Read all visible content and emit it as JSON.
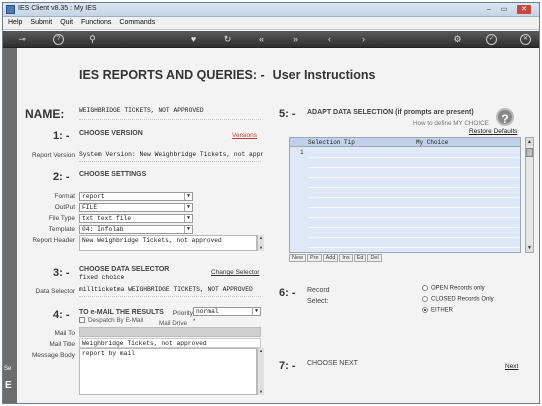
{
  "window": {
    "title": "IES Client v8.35 : My IES",
    "min": "–",
    "max": "▭",
    "close": "✕"
  },
  "menu": [
    "Help",
    "Submit",
    "Quit",
    "Functions",
    "Commands"
  ],
  "toolbar": {
    "icons": [
      "key-icon",
      "help-icon",
      "search-icon",
      "heart-icon",
      "refresh-icon",
      "rewind-icon",
      "fast-forward-icon",
      "back-icon",
      "forward-icon",
      "settings-icon",
      "check-icon",
      "close-icon"
    ],
    "glyphs": [
      "⊸",
      "?",
      "⚲",
      "♥",
      "↻",
      "«",
      "»",
      "‹",
      "›",
      "⚙",
      "✓",
      "✕"
    ]
  },
  "left_strip": {
    "text1": "Se",
    "text2": "E"
  },
  "header": {
    "title": "IES REPORTS AND QUERIES: -",
    "subtitle": "User Instructions"
  },
  "name": {
    "label": "NAME:",
    "value": "WEIGHBRIDGE TICKETS, NOT APPROVED"
  },
  "s1": {
    "num": "1: -",
    "title": "CHOOSE VERSION",
    "link": "Versions",
    "version_label": "Report Version",
    "version_value": "System Version: New Weighbridge Tickets, not appro"
  },
  "s2": {
    "num": "2: -",
    "title": "CHOOSE SETTINGS",
    "format_label": "Format",
    "format_value": "report",
    "output_label": "OutPut",
    "output_value": "FILE",
    "filetype_label": "File Type",
    "filetype_value": "txt text file",
    "template_label": "Template",
    "template_value": "04: Infolab",
    "header_label": "Report Header",
    "header_value": "New Weighbridge Tickets, not approved"
  },
  "s3": {
    "num": "3: -",
    "title": "CHOOSE DATA SELECTOR",
    "link": "Change Selector",
    "fixed": "fixed choice",
    "selector_label": "Data Selector",
    "selector_value": "millticketma WEIGHBRIDGE TICKETS, NOT APPROVED"
  },
  "s4": {
    "num": "4: -",
    "title": "TO e-MAIL THE RESULTS",
    "priority_label": "Priority",
    "priority_value": "normal",
    "despatch_label": "Despatch By E-Mail",
    "maildrive_label": "Mail Drive",
    "maildrive_value": "*",
    "mailto_label": "Mail To",
    "mailtitle_label": "Mail Title",
    "mailtitle_value": "Weighbridge Tickets, not approved",
    "mailbody_label": "Message Body",
    "mailbody_value": "report by mail"
  },
  "s5": {
    "num": "5: -",
    "title": "ADAPT DATA SELECTION (if prompts are present)",
    "howto": "How to define MY CHOICE",
    "restore": "Restore Defaults",
    "columns": [
      "Selection Tip",
      "My Choice"
    ],
    "row_numbers": [
      "1"
    ],
    "grid_buttons": [
      "New",
      "Pre",
      "Add",
      "Ins",
      "Ed",
      "Del"
    ]
  },
  "s6": {
    "num": "6: -",
    "record_label": "Record",
    "select_label": "Select:",
    "options": [
      "OPEN Records only",
      "CLOSED Records Only",
      "EITHER"
    ],
    "selected_index": 2
  },
  "s7": {
    "num": "7: -",
    "title": "CHOOSE NEXT",
    "next_link": "Next"
  },
  "colors": {
    "accent_red": "#c0392b",
    "toolbar_dark": "#3a3a3a",
    "grid_blue": "#dfe8f6"
  }
}
